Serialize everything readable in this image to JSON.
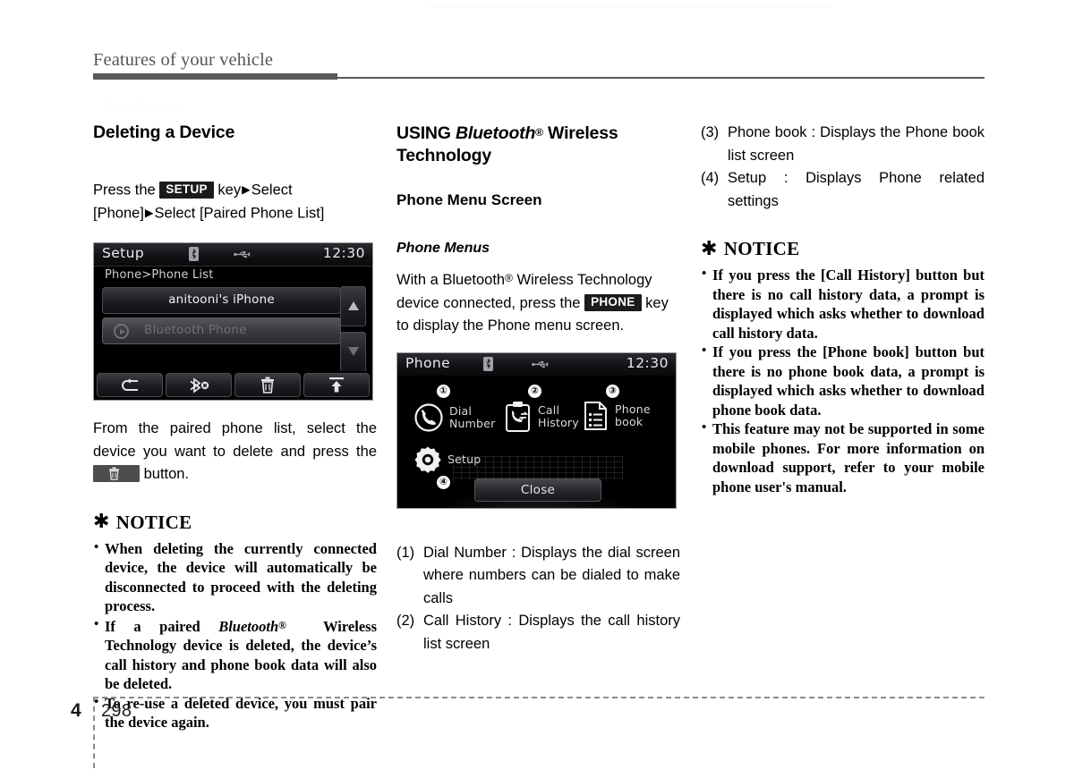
{
  "header": {
    "chapter_title": "Features of your vehicle",
    "ghost_text": "Features"
  },
  "footer": {
    "chapter_number": "4",
    "page_number": "298"
  },
  "column1": {
    "section_title": "Deleting a Device",
    "instruction_pre": "Press    the",
    "key_setup": "SETUP",
    "instruction_post": "key",
    "instruction_line1_tail": "Select",
    "instruction_line2": "[Phone]",
    "instruction_line2b": "Select [Paired Phone List]",
    "screen": {
      "title": "Setup",
      "clock": "12:30",
      "breadcrumb": "Phone>Phone List",
      "list": [
        {
          "label": "anitooni's iPhone",
          "state": "selected"
        },
        {
          "label": "Bluetooth Phone",
          "state": "dimmed"
        }
      ],
      "scroll_up": "scroll-up",
      "scroll_down": "scroll-down",
      "toolbar": [
        {
          "icon": "back-arrow-icon"
        },
        {
          "icon": "bluetooth-disconnect-icon"
        },
        {
          "icon": "trash-icon"
        },
        {
          "icon": "upload-eject-icon"
        }
      ]
    },
    "after_screen_text_1": "From the paired phone list, select the device you want to delete and press the",
    "after_screen_text_2": "button.",
    "notice_heading": "NOTICE",
    "notice_star": "✱",
    "notice_items": [
      "When deleting the currently connected device, the device will automatically be disconnected to proceed with the deleting process.",
      "If a paired Bluetooth® Wireless Technology device is deleted, the device's call history and phone book data will also be deleted.",
      "To re-use a deleted device, you must pair the device again."
    ]
  },
  "column2": {
    "section_title_pre": "USING ",
    "section_title_brand": "Bluetooth",
    "section_title_sup": "®",
    "section_title_post": " Wireless Technology",
    "sub_title": "Phone Menu Screen",
    "sub_sub_title": "Phone Menus",
    "paragraph_pre": "With    a   ",
    "paragraph_brand": "Bluetooth",
    "paragraph_sup": "®",
    "paragraph_mid": "   Wireless Technology device connected, press the",
    "key_phone": "PHONE",
    "paragraph_post": "key to display the Phone menu screen.",
    "screen": {
      "title": "Phone",
      "clock": "12:30",
      "menu_items": [
        {
          "badge": "①",
          "label_line1": "Dial",
          "label_line2": "Number",
          "icon": "dial-number-icon"
        },
        {
          "badge": "②",
          "label_line1": "Call",
          "label_line2": "History",
          "icon": "call-history-icon"
        },
        {
          "badge": "③",
          "label_line1": "Phone",
          "label_line2": "book",
          "icon": "phone-book-icon"
        },
        {
          "badge": "④",
          "label_line1": "Setup",
          "label_line2": "",
          "icon": "setup-gear-icon"
        }
      ],
      "close_label": "Close"
    },
    "numbered_items": [
      {
        "num": "(1)",
        "text": "Dial Number : Displays the dial screen where numbers can be dialed to make calls"
      },
      {
        "num": "(2)",
        "text": "Call History : Displays the call history list screen"
      }
    ]
  },
  "column3": {
    "numbered_items": [
      {
        "num": "(3)",
        "text": "Phone book : Displays the Phone book list screen"
      },
      {
        "num": "(4)",
        "text": "Setup : Displays Phone related settings"
      }
    ],
    "notice_heading": "NOTICE",
    "notice_star": "✱",
    "notice_items": [
      "If you press the [Call History] button but there is no call history data, a prompt is displayed which asks whether to download call history data.",
      "If you press the [Phone book] button but there is no phone book data, a prompt is displayed which asks whether to download phone book data.",
      "This feature may not be supported in some mobile phones. For more information on download support, refer to your mobile phone user's manual."
    ]
  }
}
